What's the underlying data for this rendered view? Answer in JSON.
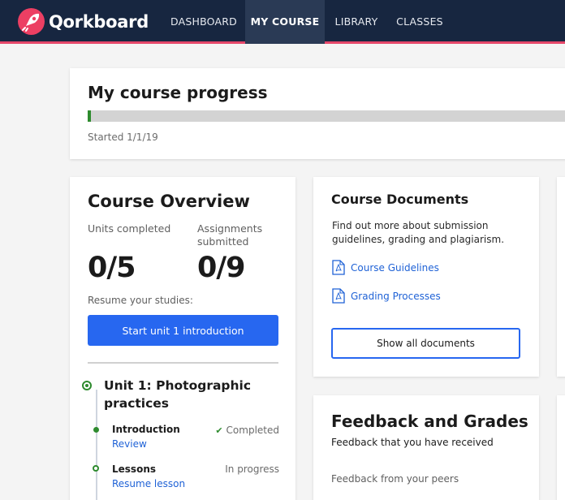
{
  "brand": {
    "name": "Qorkboard",
    "accent": "#ec3f63",
    "nav_bg": "#172640"
  },
  "nav": {
    "items": [
      {
        "label": "DASHBOARD",
        "active": false
      },
      {
        "label": "MY COURSE",
        "active": true
      },
      {
        "label": "LIBRARY",
        "active": false
      },
      {
        "label": "CLASSES",
        "active": false
      }
    ]
  },
  "progress": {
    "title": "My course progress",
    "started": "Started 1/1/19",
    "fraction": 0.007
  },
  "overview": {
    "title": "Course Overview",
    "units_label": "Units completed",
    "units_value": "0/5",
    "assignments_label": "Assignments submitted",
    "assignments_value": "0/9",
    "resume_label": "Resume your studies:",
    "resume_button": "Start unit 1 introduction",
    "unit": {
      "title": "Unit 1: Photographic practices",
      "lessons": [
        {
          "name": "Introduction",
          "link": "Review",
          "status": "Completed",
          "status_icon": "check-icon"
        },
        {
          "name": "Lessons",
          "link": "Resume lesson",
          "status": "In progress"
        }
      ]
    }
  },
  "documents": {
    "title": "Course Documents",
    "description": "Find out more about submission guidelines, grading and plagiarism.",
    "links": [
      {
        "label": "Course Guidelines",
        "icon": "pdf-icon"
      },
      {
        "label": "Grading Processes",
        "icon": "pdf-icon"
      }
    ],
    "button": "Show all documents"
  },
  "feedback": {
    "title": "Feedback and Grades",
    "subtitle": "Feedback that you have received",
    "peers_label": "Feedback from your peers"
  }
}
